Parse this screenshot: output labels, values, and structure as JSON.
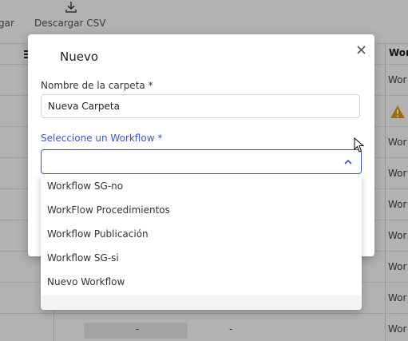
{
  "toolbar": {
    "partial_label": "gar",
    "download_csv_label": "Descargar CSV"
  },
  "table": {
    "column_header_partial": "Wor",
    "row_values": [
      "Wor",
      "",
      "Wor",
      "Wor",
      "Wor",
      "Wor",
      "Wor",
      "Wor",
      "Wor"
    ],
    "bottom_row": {
      "dash1": "-",
      "dash2": "-"
    }
  },
  "dialog": {
    "title": "Nuevo",
    "folder_name_label": "Nombre de la carpeta *",
    "folder_name_value": "Nueva Carpeta",
    "workflow_label": "Seleccione un Workflow *",
    "workflow_value": ""
  },
  "workflow_options": [
    "Workflow SG-no",
    "WorkFlow Procedimientos",
    "Workflow Publicación",
    "Workflow SG-si",
    "Nuevo Workflow"
  ],
  "colors": {
    "accent": "#3f57c9",
    "warning": "#e0a000",
    "overlay": "rgba(0,0,0,0.30)"
  },
  "icons": {
    "download": "download-icon",
    "menu": "hamburger-icon",
    "warning": "warning-icon",
    "close": "close-icon",
    "chevron": "chevron-up-icon"
  }
}
